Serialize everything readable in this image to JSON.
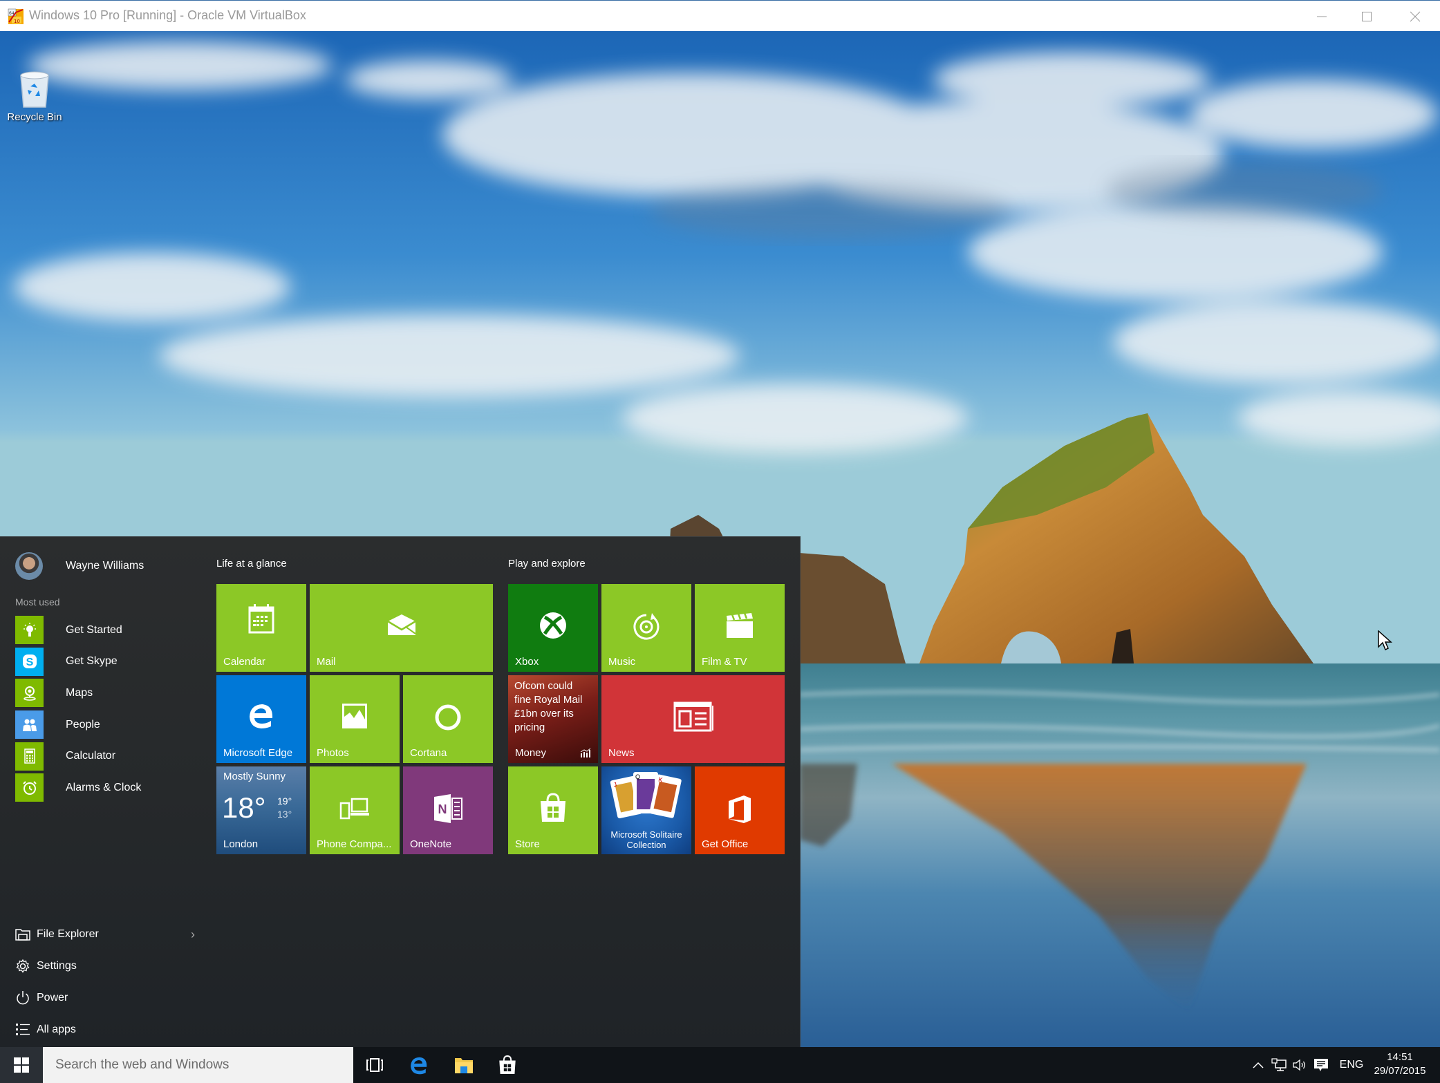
{
  "window": {
    "title": "Windows 10 Pro [Running] - Oracle VM VirtualBox",
    "controls": {
      "minimize": "minimize-icon",
      "maximize": "maximize-icon",
      "close": "close-icon"
    }
  },
  "desktop": {
    "icons": [
      {
        "label": "Recycle Bin",
        "icon": "recycle-bin-icon"
      }
    ]
  },
  "start_menu": {
    "user": {
      "name": "Wayne Williams"
    },
    "most_used_label": "Most used",
    "most_used": [
      {
        "label": "Get Started",
        "icon": "lightbulb-icon",
        "color": "#7fba00"
      },
      {
        "label": "Get Skype",
        "icon": "skype-icon",
        "color": "#00aff0"
      },
      {
        "label": "Maps",
        "icon": "maps-icon",
        "color": "#7fba00"
      },
      {
        "label": "People",
        "icon": "people-icon",
        "color": "#4a9be8"
      },
      {
        "label": "Calculator",
        "icon": "calculator-icon",
        "color": "#7fba00"
      },
      {
        "label": "Alarms & Clock",
        "icon": "alarm-clock-icon",
        "color": "#7fba00"
      }
    ],
    "bottom": [
      {
        "label": "File Explorer",
        "icon": "folder-icon",
        "has_submenu": true
      },
      {
        "label": "Settings",
        "icon": "gear-icon"
      },
      {
        "label": "Power",
        "icon": "power-icon"
      },
      {
        "label": "All apps",
        "icon": "list-icon"
      }
    ],
    "groups": [
      {
        "title": "Life at a glance",
        "tiles": [
          {
            "label": "Calendar",
            "icon": "calendar-icon",
            "color": "#8cc826",
            "size": "medium"
          },
          {
            "label": "Mail",
            "icon": "mail-icon",
            "color": "#8cc826",
            "size": "wide"
          },
          {
            "label": "Microsoft Edge",
            "icon": "edge-icon",
            "color": "#0078d7",
            "size": "medium"
          },
          {
            "label": "Photos",
            "icon": "photos-icon",
            "color": "#8cc826",
            "size": "medium"
          },
          {
            "label": "Cortana",
            "icon": "cortana-icon",
            "color": "#8cc826",
            "size": "medium"
          },
          {
            "label": "London",
            "icon": "weather-icon",
            "color": "#2c5c8c",
            "size": "medium",
            "weather": {
              "condition": "Mostly Sunny",
              "temp": "18°",
              "high": "19°",
              "low": "13°"
            }
          },
          {
            "label": "Phone Compa...",
            "icon": "phone-companion-icon",
            "color": "#8cc826",
            "size": "medium"
          },
          {
            "label": "OneNote",
            "icon": "onenote-icon",
            "color": "#80397b",
            "size": "medium"
          }
        ]
      },
      {
        "title": "Play and explore",
        "tiles": [
          {
            "label": "Xbox",
            "icon": "xbox-icon",
            "color": "#107c10",
            "size": "medium"
          },
          {
            "label": "Music",
            "icon": "music-icon",
            "color": "#8cc826",
            "size": "medium"
          },
          {
            "label": "Film & TV",
            "icon": "film-icon",
            "color": "#8cc826",
            "size": "medium"
          },
          {
            "label": "Money",
            "icon": "money-chart-icon",
            "color": "#5a1a14",
            "size": "medium",
            "headline": "Ofcom could fine Royal Mail £1bn over its pricing"
          },
          {
            "label": "News",
            "icon": "news-icon",
            "color": "#d13438",
            "size": "wide"
          },
          {
            "label": "Store",
            "icon": "store-icon",
            "color": "#8cc826",
            "size": "medium"
          },
          {
            "label": "Microsoft Solitaire Collection",
            "icon": "solitaire-cards-icon",
            "color": "#1a5aa8",
            "size": "medium"
          },
          {
            "label": "Get Office",
            "icon": "office-icon",
            "color": "#e03a00",
            "size": "medium"
          }
        ]
      }
    ]
  },
  "taskbar": {
    "search_placeholder": "Search the web and Windows",
    "pinned": [
      {
        "name": "task-view",
        "icon": "task-view-icon"
      },
      {
        "name": "edge",
        "icon": "edge-icon"
      },
      {
        "name": "file-explorer",
        "icon": "folder-icon"
      },
      {
        "name": "store",
        "icon": "store-icon"
      }
    ],
    "tray": {
      "language": "ENG",
      "time": "14:51",
      "date": "29/07/2015"
    }
  }
}
